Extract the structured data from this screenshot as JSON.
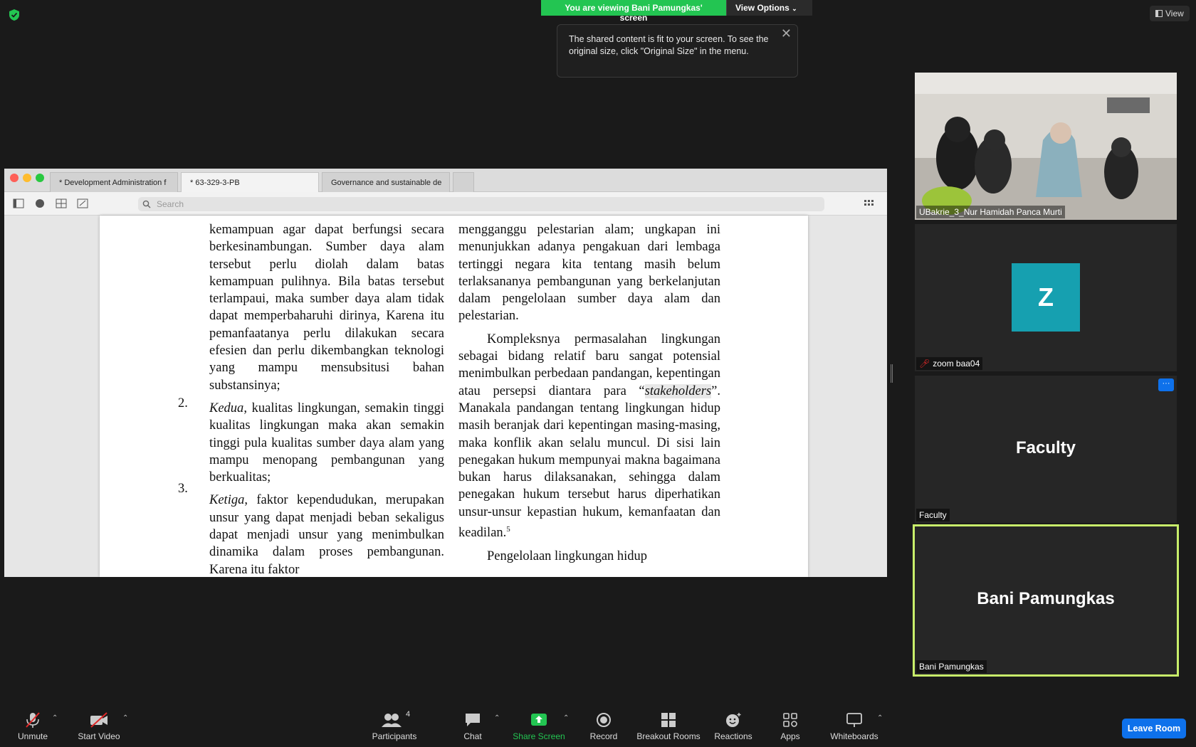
{
  "banner": {
    "viewing": "You are viewing Bani Pamungkas' screen",
    "view_options": "View Options",
    "tooltip": "The shared content is fit to your screen. To see the original size, click \"Original Size\" in the menu.",
    "view_button": "View"
  },
  "viewer": {
    "tabs": [
      "* Development Administration f",
      "* 63-329-3-PB",
      "Governance and sustainable de"
    ],
    "search_placeholder": "Search"
  },
  "document": {
    "left": {
      "p1": "kemampuan agar dapat berfungsi secara berkesinambungan. Sumber daya alam tersebut perlu diolah dalam batas kemampuan pulihnya. Bila batas tersebut terlampaui, maka sumber daya alam tidak dapat memperbaharuhi dirinya, Karena itu pemanfaatanya perlu dilakukan secara efesien dan perlu dikembangkan teknologi yang mampu mensubsitusi bahan substansinya;",
      "n2": "2.",
      "p2_em": "Kedua",
      "p2": ", kualitas lingkungan, semakin tinggi kualitas lingkungan maka akan semakin tinggi pula kualitas sumber daya alam yang mampu menopang pembangunan yang berkualitas;",
      "n3": "3.",
      "p3_em": "Ketiga",
      "p3": ", faktor kependudukan, merupakan unsur yang dapat menjadi beban sekaligus dapat menjadi unsur yang menimbulkan dinamika dalam proses pembangunan. Karena itu faktor"
    },
    "right": {
      "p1": "mengganggu pelestarian alam; ungkapan ini menunjukkan adanya pengakuan dari lembaga tertinggi negara kita tentang masih belum terlaksananya pembangunan yang berkelanjutan dalam pengelolaan sumber daya alam dan pelestarian.",
      "p2a": "Kompleksnya permasalahan lingkungan sebagai bidang relatif baru sangat potensial menimbulkan perbedaan pandangan, kepentingan atau persepsi diantara para “",
      "p2_em": "stakeholders",
      "p2b": "”. Manakala pandangan tentang lingkungan hidup masih beranjak dari kepentingan masing-masing, maka konflik akan selalu muncul. Di sisi lain penegakan hukum mempunyai makna bagaimana bukan harus dilaksanakan, sehingga dalam penegakan hukum tersebut harus diperhatikan unsur-unsur kepastian hukum, kemanfaatan dan keadilan.",
      "p2_sup": "5",
      "p3": "Pengelolaan lingkungan hidup"
    }
  },
  "participants": {
    "tile1_name": "UBakrie_3_Nur Hamidah Panca Murti",
    "tile2_avatar": "Z",
    "tile2_name": "zoom baa04",
    "tile3_big": "Faculty",
    "tile3_name": "Faculty",
    "tile3_more": "···",
    "tile4_big": "Bani Pamungkas",
    "tile4_name": "Bani Pamungkas"
  },
  "toolbar": {
    "unmute": "Unmute",
    "start_video": "Start Video",
    "participants": "Participants",
    "participants_count": "4",
    "chat": "Chat",
    "share_screen": "Share Screen",
    "record": "Record",
    "breakout": "Breakout Rooms",
    "reactions": "Reactions",
    "apps": "Apps",
    "whiteboards": "Whiteboards",
    "leave": "Leave Room"
  },
  "colors": {
    "share_green": "#23c552",
    "leave_blue": "#0e71eb",
    "active_border": "#c8ee6a",
    "avatar_teal": "#16a0b0"
  }
}
